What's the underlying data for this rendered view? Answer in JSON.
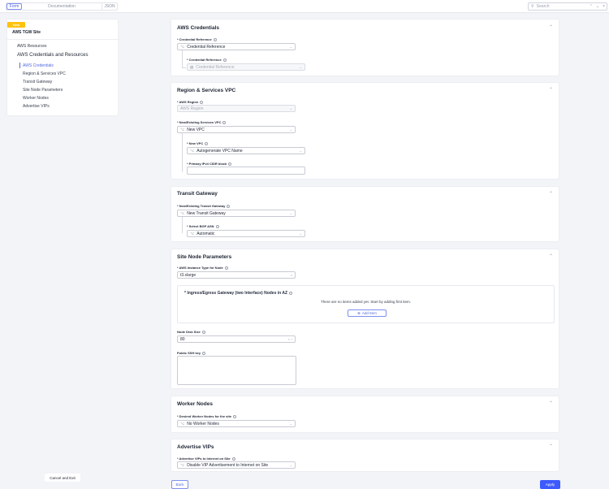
{
  "topbar": {
    "tabs": [
      "Form",
      "Documentation",
      "JSON"
    ],
    "search_placeholder": "Search"
  },
  "sidebar": {
    "badge": "New",
    "site_name": "AWS TGW Site",
    "items": [
      {
        "label": "AWS Resources"
      },
      {
        "label": "AWS Credentials and Resources"
      }
    ],
    "subitems": [
      "AWS Credentials",
      "Region & Services VPC",
      "Transit Gateway",
      "Site Node Parameters",
      "Worker Nodes",
      "Advertise VIPs"
    ],
    "cancel": "Cancel and Exit"
  },
  "sections": {
    "cred": {
      "title": "AWS Credentials",
      "f1_label": "* Credential Reference",
      "f1_value": "Credential Reference",
      "f2_label": "* Credential Reference",
      "f2_placeholder": "Credential Reference"
    },
    "region": {
      "title": "Region & Services VPC",
      "f1_label": "* AWS Region",
      "f1_placeholder": "AWS Region",
      "f2_label": "* New/Existing Services VPC",
      "f2_value": "New VPC",
      "f3_label": "* New VPC",
      "f3_value": "Autogenerate VPC Name",
      "f4_label": "* Primary IPv4 CIDR block",
      "f4_value": ""
    },
    "tgw": {
      "title": "Transit Gateway",
      "f1_label": "* New/Existing Transit Gateway",
      "f1_value": "New Transit Gateway",
      "f2_label": "* Select BGP ASN",
      "f2_value": "Automatic"
    },
    "node": {
      "title": "Site Node Parameters",
      "f1_label": "* AWS Instance Type for Node",
      "f1_value": "t3.xlarge",
      "list_title": "* Ingress/Egress Gateway (two Interface) Nodes in AZ",
      "empty_text": "There are no items added yet. Start by adding first item.",
      "add_label": "Add Item",
      "disk_label": "Node Disk Size",
      "disk_value": "80",
      "ssh_label": "Public SSH key",
      "ssh_value": ""
    },
    "worker": {
      "title": "Worker Nodes",
      "f1_label": "* Desired Worker Nodes for the site",
      "f1_value": "No Worker Nodes"
    },
    "vips": {
      "title": "Advertise VIPs",
      "f1_label": "* Advertise VIPs to Internet on Site",
      "f1_value": "Disable VIP Advertisement to Internet on Site"
    }
  },
  "footer": {
    "back": "Back",
    "apply": "Apply"
  },
  "colors": {
    "accent": "#5468e0",
    "badge": "#ffc20e",
    "apply": "#3d5afe"
  }
}
